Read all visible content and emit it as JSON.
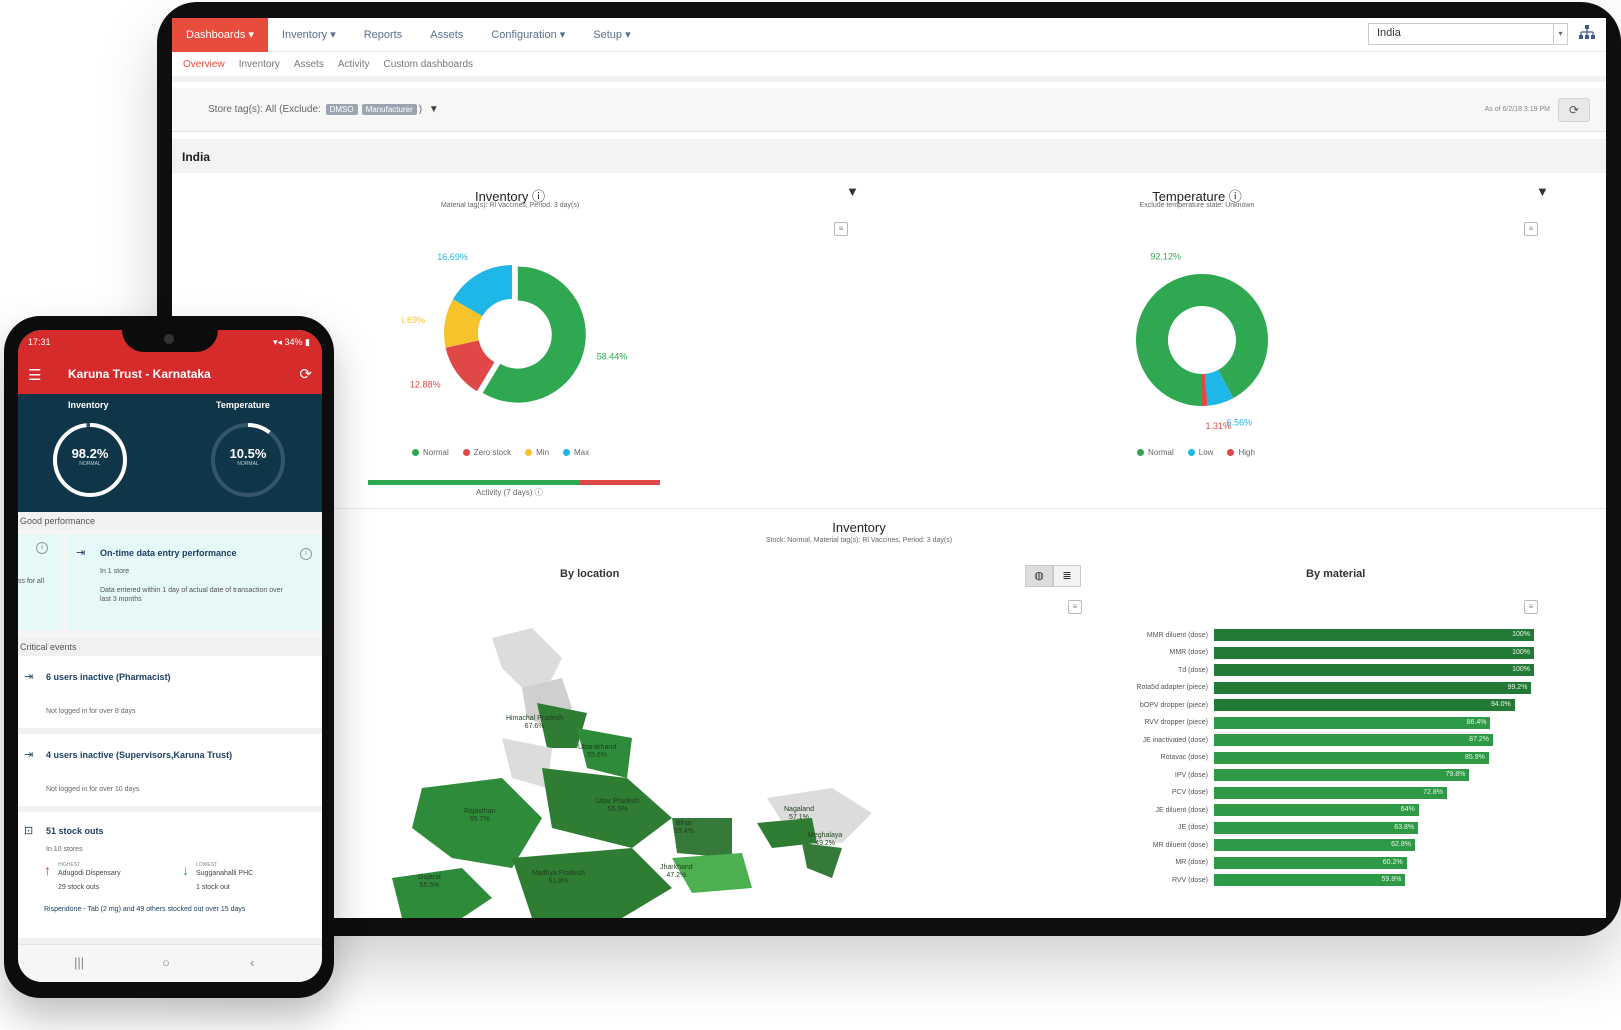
{
  "desktop": {
    "nav": {
      "items": [
        "Dashboards ▾",
        "Inventory ▾",
        "Reports",
        "Assets",
        "Configuration ▾",
        "Setup ▾"
      ],
      "search_value": "India"
    },
    "subnav": [
      "Overview",
      "Inventory",
      "Assets",
      "Activity",
      "Custom dashboards"
    ],
    "filter": {
      "text": "Store tag(s): All (Exclude:",
      "tags": [
        "DMSO",
        "Manufacturer"
      ],
      "close": ")",
      "asof": "As of 6/2/18 3:19 PM"
    },
    "region": "India",
    "inventory_widget": {
      "title": "Inventory ⓘ",
      "subtitle": "Material tag(s): Rl Vaccines, Period: 3 day(s)",
      "legend": [
        "Normal",
        "Zero stock",
        "Min",
        "Max"
      ],
      "activity_label": "Activity (7 days) ⓘ"
    },
    "temperature_widget": {
      "title": "Temperature ⓘ",
      "subtitle": "Exclude temperature state: Unknown",
      "legend": [
        "Normal",
        "Low",
        "High"
      ]
    },
    "inventory_section": {
      "title": "Inventory",
      "subtitle": "Stock: Normal, Material tag(s): Rl Vaccines, Period: 3 day(s)",
      "by_location": "By location",
      "by_material": "By material"
    },
    "map_labels": [
      {
        "name": "Himachal Pradesh",
        "value": "67.6%"
      },
      {
        "name": "Uttarakhand",
        "value": "55.6%"
      },
      {
        "name": "Rajasthan",
        "value": "65.7%"
      },
      {
        "name": "Uttar Pradesh",
        "value": "55.5%"
      },
      {
        "name": "Bihar",
        "value": "59.4%"
      },
      {
        "name": "Nagaland",
        "value": "57.1%"
      },
      {
        "name": "Meghalaya",
        "value": "49.2%"
      },
      {
        "name": "Gujarat",
        "value": "55.5%"
      },
      {
        "name": "Madhya Pradesh",
        "value": "51.8%"
      },
      {
        "name": "Jharkhand",
        "value": "47.2%"
      }
    ],
    "colors": {
      "green": "#2fa851",
      "red": "#e04848",
      "yellow": "#f6c32d",
      "blue": "#1fb6e8",
      "nav_active": "#e84c3d"
    }
  },
  "chart_data": [
    {
      "type": "pie",
      "title": "Inventory",
      "categories": [
        "Normal",
        "Zero stock",
        "Min",
        "Max"
      ],
      "values": [
        58.44,
        12.88,
        11.69,
        16.69
      ],
      "labels": [
        "58.44%",
        "12.88%",
        "11.69%",
        "16.69%"
      ],
      "colors": [
        "#2fa851",
        "#e04848",
        "#f6c32d",
        "#1fb6e8"
      ],
      "legend": "bottom"
    },
    {
      "type": "pie",
      "title": "Temperature",
      "categories": [
        "Normal",
        "Low",
        "High"
      ],
      "values": [
        92.12,
        6.56,
        1.31
      ],
      "labels": [
        "92.12%",
        "6.56%",
        "1.31%"
      ],
      "colors": [
        "#2fa851",
        "#1fb6e8",
        "#e04848"
      ],
      "legend": "bottom"
    },
    {
      "type": "bar",
      "title": "By material",
      "categories": [
        "MMR diluent (dose)",
        "MMR (dose)",
        "Td (dose)",
        "Rota5d adapter (piece)",
        "bOPV dropper (piece)",
        "RVV dropper (piece)",
        "JE inactivated (dose)",
        "Rotavac (dose)",
        "IPV (dose)",
        "PCV (dose)",
        "JE diluent (dose)",
        "JE (dose)",
        "MR diluent (dose)",
        "MR (dose)",
        "RVV (dose)"
      ],
      "values": [
        100,
        100,
        100,
        99.2,
        94,
        86.4,
        87.2,
        85.9,
        79.8,
        72.8,
        64,
        63.8,
        62.8,
        60.2,
        59.8
      ],
      "labels": [
        "100%",
        "100%",
        "100%",
        "99.2%",
        "94.0%",
        "86.4%",
        "87.2%",
        "85.9%",
        "79.8%",
        "72.8%",
        "64%",
        "63.8%",
        "62.8%",
        "60.2%",
        "59.8%"
      ],
      "orientation": "horizontal"
    }
  ],
  "phone": {
    "status_time": "17:31",
    "status_right": "▾◂ 34% ▮",
    "app_title": "Karuna Trust - Karnataka",
    "summary": {
      "inventory_label": "Inventory",
      "temperature_label": "Temperature",
      "inventory_value": "98.2%",
      "inventory_caption": "NORMAL",
      "temperature_value": "10.5%",
      "temperature_caption": "NORMAL",
      "inventory_fraction": 0.982,
      "temperature_fraction": 0.105
    },
    "good_performance": "Good performance",
    "card": {
      "left_text": "ss for all",
      "title": "On-time data entry performance",
      "sub": "In 1 store",
      "desc": "Data entered within 1 day of actual date of transaction over last 3 months"
    },
    "critical_events": "Critical events",
    "events": [
      {
        "title": "6 users inactive (Pharmacist)",
        "sub": "Not logged in for over 8 days"
      },
      {
        "title": "4 users inactive (Supervisors,Karuna Trust)",
        "sub": "Not logged in for over 10 days"
      }
    ],
    "stockouts": {
      "title": "51 stock outs",
      "sub": "In 10 stores",
      "highest_label": "HIGHEST",
      "highest_name": "Adugodi Dispensary",
      "highest_value": "29 stock outs",
      "lowest_label": "LOWEST",
      "lowest_name": "Sugganahalli PHC",
      "lowest_value": "1 stock out",
      "footer": "Risperidone - Tab (2 mg) and 49 others stocked out over 15 days"
    }
  }
}
